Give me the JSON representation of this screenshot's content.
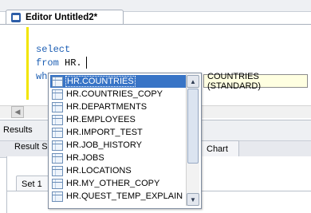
{
  "editor_tab": {
    "title": "Editor Untitled2*"
  },
  "code": {
    "line1": "select",
    "line2_keyword": "from",
    "line2_text": " HR.",
    "line3": "wh"
  },
  "results": {
    "panel_label": "Results",
    "result_tab_label": "Result S",
    "chart_tab_label": "Chart",
    "set_tab_label": "Set 1"
  },
  "autocomplete": {
    "items": [
      "HR.COUNTRIES",
      "HR.COUNTRIES_COPY",
      "HR.DEPARTMENTS",
      "HR.EMPLOYEES",
      "HR.IMPORT_TEST",
      "HR.JOB_HISTORY",
      "HR.JOBS",
      "HR.LOCATIONS",
      "HR.MY_OTHER_COPY",
      "HR.QUEST_TEMP_EXPLAIN"
    ],
    "selected_item": "HR.COUNTRIES",
    "tooltip": "COUNTRIES (STANDARD)"
  }
}
